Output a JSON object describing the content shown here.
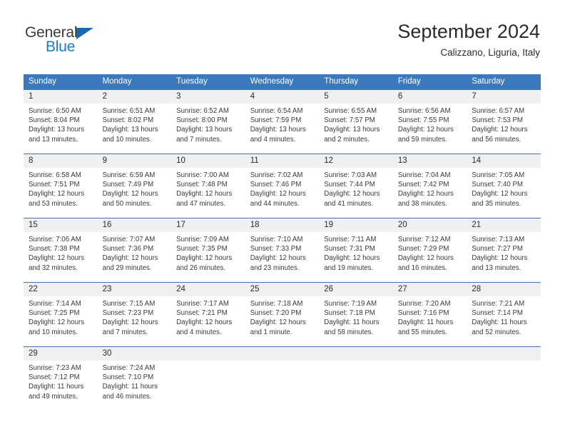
{
  "brand": {
    "name_part1": "General",
    "name_part2": "Blue",
    "triangle_icon": "triangle-icon",
    "color_dark": "#3b3b3b",
    "color_blue": "#1a7ac4",
    "color_triangle": "#1668b3"
  },
  "header": {
    "month_title": "September 2024",
    "location": "Calizzano, Liguria, Italy"
  },
  "theme": {
    "header_bg": "#3b78bc",
    "header_text": "#ffffff",
    "daynum_bg": "#f0f0f0",
    "body_text": "#3a3a3a",
    "border": "#3b78bc"
  },
  "weekdays": [
    "Sunday",
    "Monday",
    "Tuesday",
    "Wednesday",
    "Thursday",
    "Friday",
    "Saturday"
  ],
  "weeks": [
    [
      {
        "day": "1",
        "sunrise": "Sunrise: 6:50 AM",
        "sunset": "Sunset: 8:04 PM",
        "daylight_1": "Daylight: 13 hours",
        "daylight_2": "and 13 minutes."
      },
      {
        "day": "2",
        "sunrise": "Sunrise: 6:51 AM",
        "sunset": "Sunset: 8:02 PM",
        "daylight_1": "Daylight: 13 hours",
        "daylight_2": "and 10 minutes."
      },
      {
        "day": "3",
        "sunrise": "Sunrise: 6:52 AM",
        "sunset": "Sunset: 8:00 PM",
        "daylight_1": "Daylight: 13 hours",
        "daylight_2": "and 7 minutes."
      },
      {
        "day": "4",
        "sunrise": "Sunrise: 6:54 AM",
        "sunset": "Sunset: 7:59 PM",
        "daylight_1": "Daylight: 13 hours",
        "daylight_2": "and 4 minutes."
      },
      {
        "day": "5",
        "sunrise": "Sunrise: 6:55 AM",
        "sunset": "Sunset: 7:57 PM",
        "daylight_1": "Daylight: 13 hours",
        "daylight_2": "and 2 minutes."
      },
      {
        "day": "6",
        "sunrise": "Sunrise: 6:56 AM",
        "sunset": "Sunset: 7:55 PM",
        "daylight_1": "Daylight: 12 hours",
        "daylight_2": "and 59 minutes."
      },
      {
        "day": "7",
        "sunrise": "Sunrise: 6:57 AM",
        "sunset": "Sunset: 7:53 PM",
        "daylight_1": "Daylight: 12 hours",
        "daylight_2": "and 56 minutes."
      }
    ],
    [
      {
        "day": "8",
        "sunrise": "Sunrise: 6:58 AM",
        "sunset": "Sunset: 7:51 PM",
        "daylight_1": "Daylight: 12 hours",
        "daylight_2": "and 53 minutes."
      },
      {
        "day": "9",
        "sunrise": "Sunrise: 6:59 AM",
        "sunset": "Sunset: 7:49 PM",
        "daylight_1": "Daylight: 12 hours",
        "daylight_2": "and 50 minutes."
      },
      {
        "day": "10",
        "sunrise": "Sunrise: 7:00 AM",
        "sunset": "Sunset: 7:48 PM",
        "daylight_1": "Daylight: 12 hours",
        "daylight_2": "and 47 minutes."
      },
      {
        "day": "11",
        "sunrise": "Sunrise: 7:02 AM",
        "sunset": "Sunset: 7:46 PM",
        "daylight_1": "Daylight: 12 hours",
        "daylight_2": "and 44 minutes."
      },
      {
        "day": "12",
        "sunrise": "Sunrise: 7:03 AM",
        "sunset": "Sunset: 7:44 PM",
        "daylight_1": "Daylight: 12 hours",
        "daylight_2": "and 41 minutes."
      },
      {
        "day": "13",
        "sunrise": "Sunrise: 7:04 AM",
        "sunset": "Sunset: 7:42 PM",
        "daylight_1": "Daylight: 12 hours",
        "daylight_2": "and 38 minutes."
      },
      {
        "day": "14",
        "sunrise": "Sunrise: 7:05 AM",
        "sunset": "Sunset: 7:40 PM",
        "daylight_1": "Daylight: 12 hours",
        "daylight_2": "and 35 minutes."
      }
    ],
    [
      {
        "day": "15",
        "sunrise": "Sunrise: 7:06 AM",
        "sunset": "Sunset: 7:38 PM",
        "daylight_1": "Daylight: 12 hours",
        "daylight_2": "and 32 minutes."
      },
      {
        "day": "16",
        "sunrise": "Sunrise: 7:07 AM",
        "sunset": "Sunset: 7:36 PM",
        "daylight_1": "Daylight: 12 hours",
        "daylight_2": "and 29 minutes."
      },
      {
        "day": "17",
        "sunrise": "Sunrise: 7:09 AM",
        "sunset": "Sunset: 7:35 PM",
        "daylight_1": "Daylight: 12 hours",
        "daylight_2": "and 26 minutes."
      },
      {
        "day": "18",
        "sunrise": "Sunrise: 7:10 AM",
        "sunset": "Sunset: 7:33 PM",
        "daylight_1": "Daylight: 12 hours",
        "daylight_2": "and 23 minutes."
      },
      {
        "day": "19",
        "sunrise": "Sunrise: 7:11 AM",
        "sunset": "Sunset: 7:31 PM",
        "daylight_1": "Daylight: 12 hours",
        "daylight_2": "and 19 minutes."
      },
      {
        "day": "20",
        "sunrise": "Sunrise: 7:12 AM",
        "sunset": "Sunset: 7:29 PM",
        "daylight_1": "Daylight: 12 hours",
        "daylight_2": "and 16 minutes."
      },
      {
        "day": "21",
        "sunrise": "Sunrise: 7:13 AM",
        "sunset": "Sunset: 7:27 PM",
        "daylight_1": "Daylight: 12 hours",
        "daylight_2": "and 13 minutes."
      }
    ],
    [
      {
        "day": "22",
        "sunrise": "Sunrise: 7:14 AM",
        "sunset": "Sunset: 7:25 PM",
        "daylight_1": "Daylight: 12 hours",
        "daylight_2": "and 10 minutes."
      },
      {
        "day": "23",
        "sunrise": "Sunrise: 7:15 AM",
        "sunset": "Sunset: 7:23 PM",
        "daylight_1": "Daylight: 12 hours",
        "daylight_2": "and 7 minutes."
      },
      {
        "day": "24",
        "sunrise": "Sunrise: 7:17 AM",
        "sunset": "Sunset: 7:21 PM",
        "daylight_1": "Daylight: 12 hours",
        "daylight_2": "and 4 minutes."
      },
      {
        "day": "25",
        "sunrise": "Sunrise: 7:18 AM",
        "sunset": "Sunset: 7:20 PM",
        "daylight_1": "Daylight: 12 hours",
        "daylight_2": "and 1 minute."
      },
      {
        "day": "26",
        "sunrise": "Sunrise: 7:19 AM",
        "sunset": "Sunset: 7:18 PM",
        "daylight_1": "Daylight: 11 hours",
        "daylight_2": "and 58 minutes."
      },
      {
        "day": "27",
        "sunrise": "Sunrise: 7:20 AM",
        "sunset": "Sunset: 7:16 PM",
        "daylight_1": "Daylight: 11 hours",
        "daylight_2": "and 55 minutes."
      },
      {
        "day": "28",
        "sunrise": "Sunrise: 7:21 AM",
        "sunset": "Sunset: 7:14 PM",
        "daylight_1": "Daylight: 11 hours",
        "daylight_2": "and 52 minutes."
      }
    ],
    [
      {
        "day": "29",
        "sunrise": "Sunrise: 7:23 AM",
        "sunset": "Sunset: 7:12 PM",
        "daylight_1": "Daylight: 11 hours",
        "daylight_2": "and 49 minutes."
      },
      {
        "day": "30",
        "sunrise": "Sunrise: 7:24 AM",
        "sunset": "Sunset: 7:10 PM",
        "daylight_1": "Daylight: 11 hours",
        "daylight_2": "and 46 minutes."
      },
      {
        "day": "",
        "sunrise": "",
        "sunset": "",
        "daylight_1": "",
        "daylight_2": ""
      },
      {
        "day": "",
        "sunrise": "",
        "sunset": "",
        "daylight_1": "",
        "daylight_2": ""
      },
      {
        "day": "",
        "sunrise": "",
        "sunset": "",
        "daylight_1": "",
        "daylight_2": ""
      },
      {
        "day": "",
        "sunrise": "",
        "sunset": "",
        "daylight_1": "",
        "daylight_2": ""
      },
      {
        "day": "",
        "sunrise": "",
        "sunset": "",
        "daylight_1": "",
        "daylight_2": ""
      }
    ]
  ]
}
